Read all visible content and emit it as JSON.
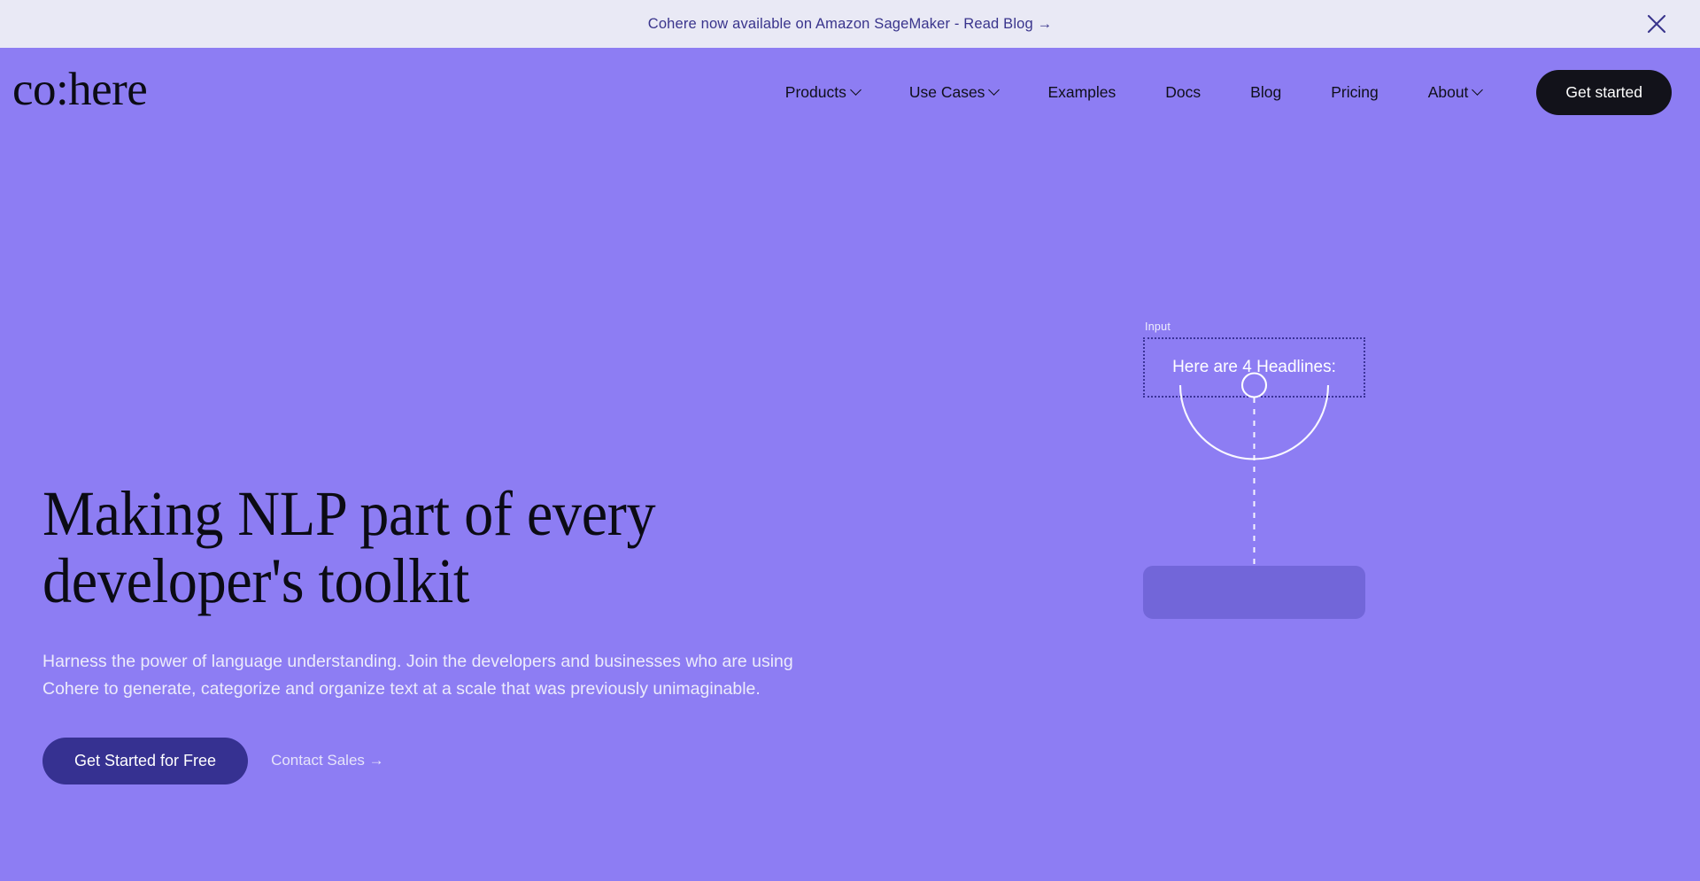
{
  "banner": {
    "text": "Cohere now available on Amazon SageMaker - Read Blog →",
    "close_icon": "close-icon",
    "background_color": "#e9e9f5",
    "text_color": "#39348c"
  },
  "header": {
    "logo": "co:here",
    "nav": [
      {
        "label": "Products",
        "has_dropdown": true
      },
      {
        "label": "Use Cases",
        "has_dropdown": true
      },
      {
        "label": "Examples",
        "has_dropdown": false
      },
      {
        "label": "Docs",
        "has_dropdown": false
      },
      {
        "label": "Blog",
        "has_dropdown": false
      },
      {
        "label": "Pricing",
        "has_dropdown": false
      },
      {
        "label": "About",
        "has_dropdown": true
      }
    ],
    "cta": "Get started"
  },
  "hero": {
    "headline": "Making NLP part of every\ndeveloper's toolkit",
    "subcopy": "Harness the power of language understanding. Join the developers and businesses who are using Cohere to generate, categorize and organize text at a scale that was previously unimaginable.",
    "primary_cta": "Get Started for Free",
    "secondary_cta": "Contact Sales →",
    "background_color": "#8d7df3",
    "primary_cta_color": "#363191"
  },
  "illustration": {
    "input_label": "Input",
    "input_text": "Here are 4 Headlines:",
    "dotted_border_color": "#3b3398",
    "arc_color": "#ffffff",
    "output_block_color": "#7266d9"
  }
}
